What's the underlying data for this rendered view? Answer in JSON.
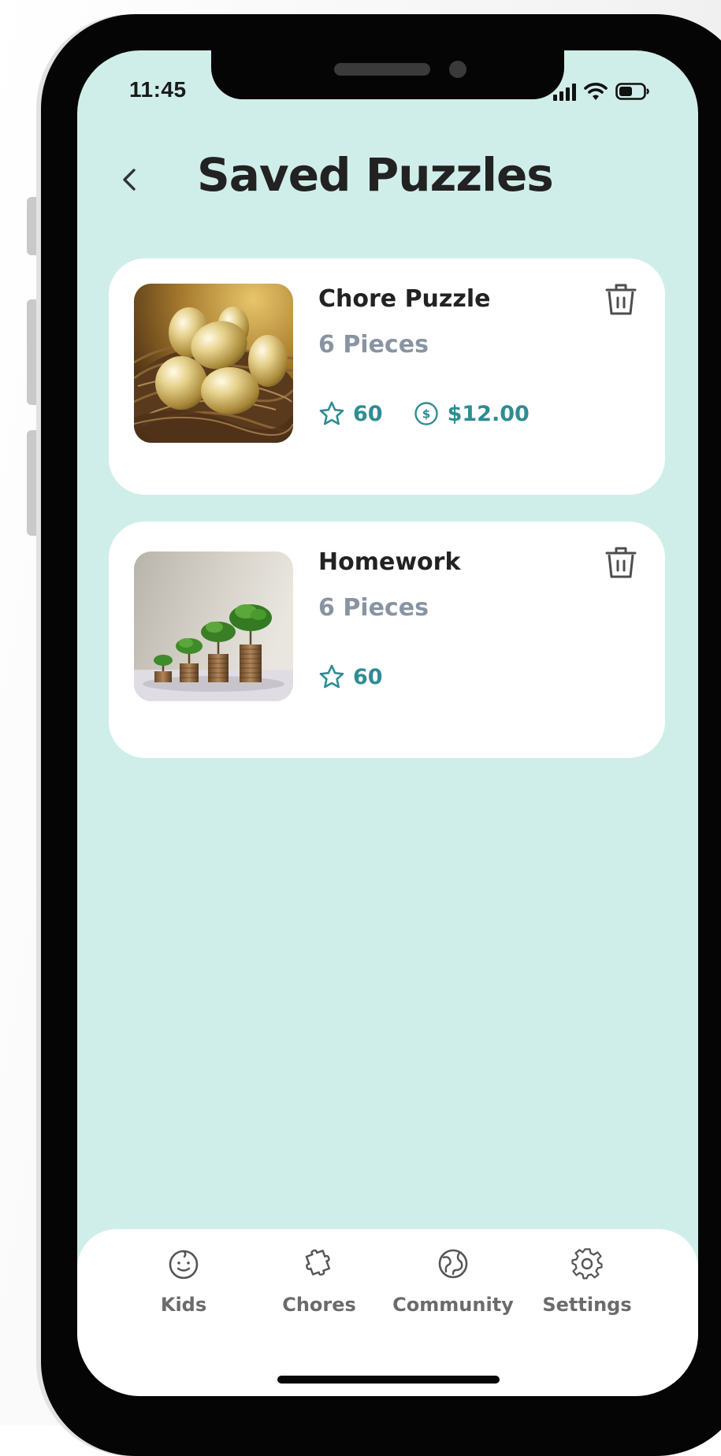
{
  "status": {
    "time": "11:45"
  },
  "header": {
    "back_icon": "chevron-left-icon",
    "title": "Saved Puzzles"
  },
  "puzzles": [
    {
      "title": "Chore Puzzle",
      "pieces": "6 Pieces",
      "image": "golden-eggs-in-nest",
      "stars": "60",
      "price": "$12.00"
    },
    {
      "title": "Homework",
      "pieces": "6 Pieces",
      "image": "coin-stacks-with-trees",
      "stars": "60"
    }
  ],
  "tabbar": {
    "items": [
      {
        "label": "Kids",
        "icon": "face-icon"
      },
      {
        "label": "Chores",
        "icon": "puzzle-icon"
      },
      {
        "label": "Community",
        "icon": "globe-icon"
      },
      {
        "label": "Settings",
        "icon": "gear-icon"
      }
    ]
  },
  "colors": {
    "screen_background": "#d0eee9",
    "accent": "#2e8d94",
    "title_text": "#222222",
    "muted_text": "#8894a2"
  }
}
